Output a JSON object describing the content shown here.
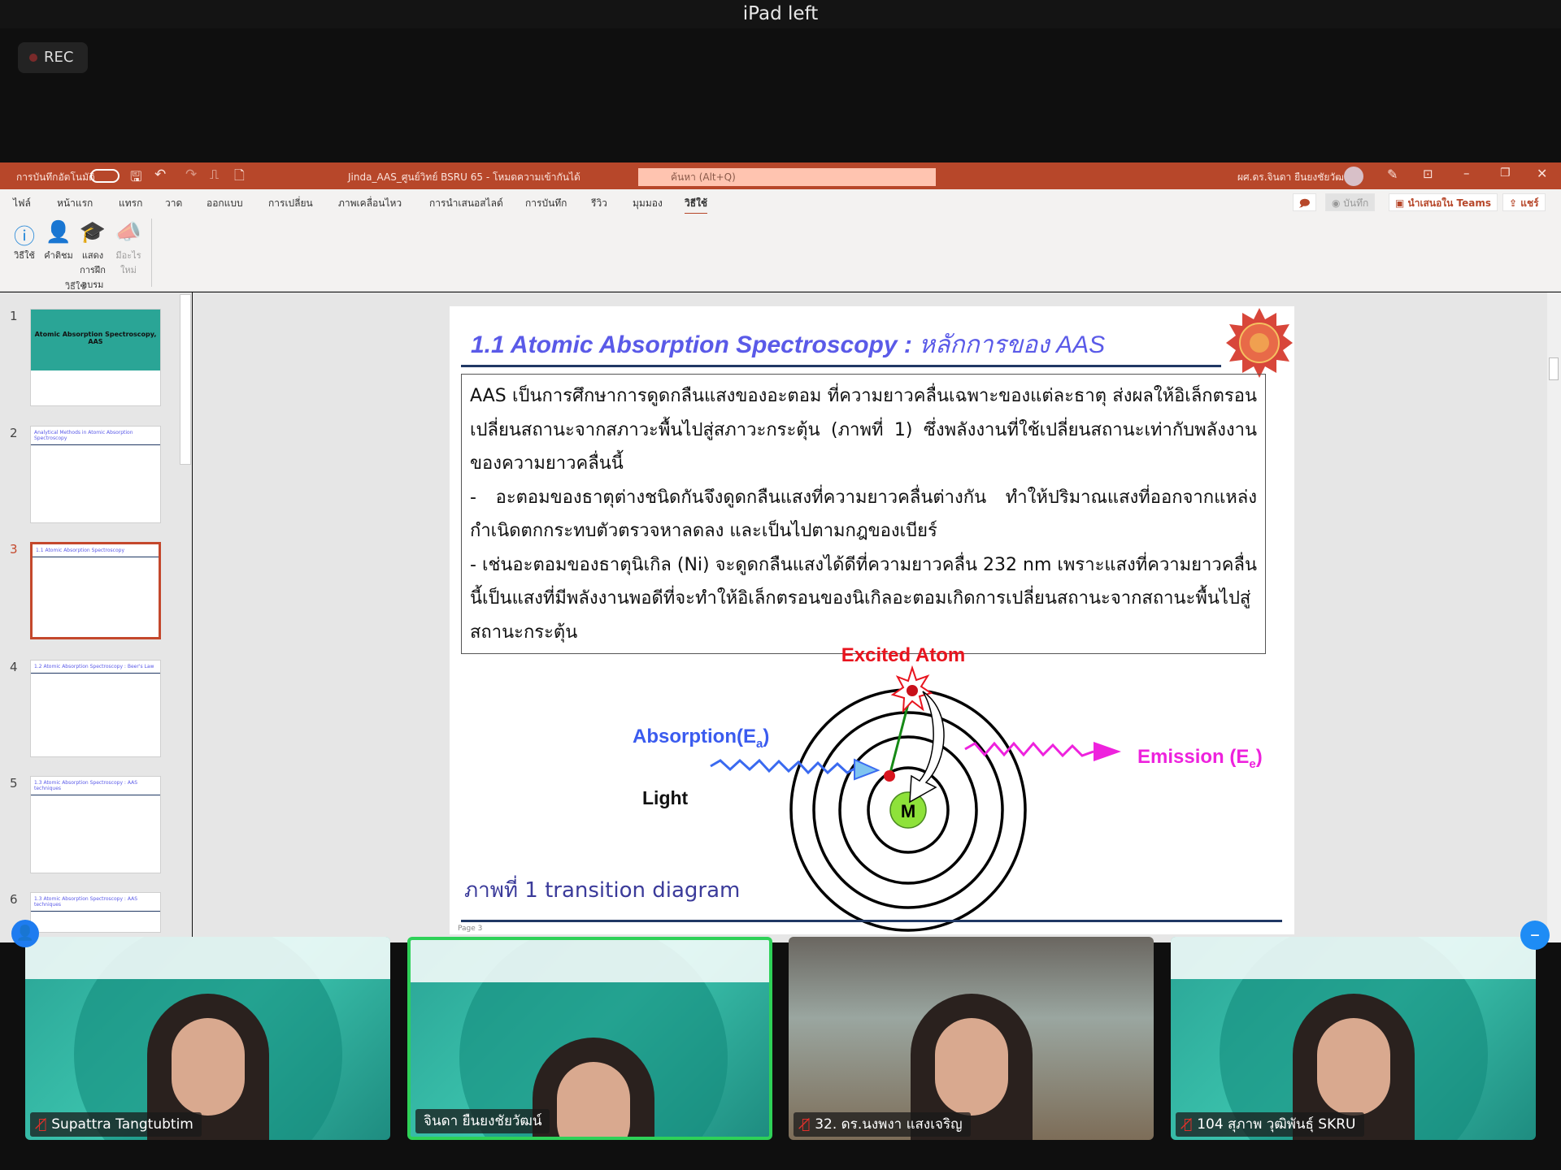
{
  "device": {
    "title": "iPad left",
    "rec_label": "REC"
  },
  "titlebar": {
    "autosave": "การบันทึกอัตโนมัติ",
    "filename": "Jinda_AAS_ศูนย์วิทย์ BSRU 65 - โหมดความเข้ากันได้",
    "search_placeholder": "ค้นหา (Alt+Q)",
    "user": "ผศ.ดร.จินดา ยืนยงชัยวัฒน์"
  },
  "tabs": [
    "ไฟล์",
    "หน้าแรก",
    "แทรก",
    "วาด",
    "ออกแบบ",
    "การเปลี่ยน",
    "ภาพเคลื่อนไหว",
    "การนำเสนอสไลด์",
    "การบันทึก",
    "รีวิว",
    "มุมมอง",
    "วิธีใช้"
  ],
  "active_tab": "วิธีใช้",
  "ribbon": {
    "buttons": [
      {
        "icon": "help-icon",
        "label": "วิธีใช้"
      },
      {
        "icon": "feedback-icon",
        "label": "คำติชม"
      },
      {
        "icon": "training-icon",
        "label": "แสดงการฝึกอบรม"
      },
      {
        "icon": "whats-new-icon",
        "label": "มีอะไรใหม่"
      }
    ],
    "group": "วิธีใช้",
    "right": {
      "record": "บันทึก",
      "present_teams": "นำเสนอใน Teams",
      "share": "แชร์"
    }
  },
  "thumbnails": [
    {
      "num": "1",
      "text": "Atomic Absorption Spectroscopy, AAS"
    },
    {
      "num": "2",
      "text": "Analytical Methods in Atomic Absorption Spectroscopy"
    },
    {
      "num": "3",
      "text": "1.1 Atomic Absorption Spectroscopy"
    },
    {
      "num": "4",
      "text": "1.2 Atomic Absorption Spectroscopy : Beer's Law"
    },
    {
      "num": "5",
      "text": "1.3 Atomic Absorption Spectroscopy : AAS techniques"
    },
    {
      "num": "6",
      "text": "1.3 Atomic Absorption Spectroscopy : AAS techniques"
    }
  ],
  "selected_slide": "3",
  "slide": {
    "title_en": "1.1 Atomic Absorption Spectroscopy : ",
    "title_th": "หลักการของ AAS",
    "paragraphs": [
      "AAS เป็นการศึกษาการดูดกลืนแสงของอะตอม ที่ความยาวคลื่นเฉพาะของแต่ละธาตุ ส่งผลให้อิเล็กตรอนเปลี่ยนสถานะจากสภาวะพื้นไปสู่สภาวะกระตุ้น (ภาพที่ 1) ซึ่งพลังงานที่ใช้เปลี่ยนสถานะเท่ากับพลังงานของความยาวคลื่นนี้",
      "- อะตอมของธาตุต่างชนิดกันจึงดูดกลืนแสงที่ความยาวคลื่นต่างกัน ทำให้ปริมาณแสงที่ออกจากแหล่งกำเนิดตกกระทบตัวตรวจหาลดลง และเป็นไปตามกฎของเบียร์",
      "- เช่นอะตอมของธาตุนิเกิล (Ni) จะดูดกลืนแสงได้ดีที่ความยาวคลื่น 232 nm เพราะแสงที่ความยาวคลื่นนี้เป็นแสงที่มีพลังงานพอดีที่จะทำให้อิเล็กตรอนของนิเกิลอะตอมเกิดการเปลี่ยนสถานะจากสถานะพื้นไปสู่สถานะกระตุ้น"
    ],
    "diagram": {
      "excited": "Excited Atom",
      "absorption": "Absorption(E",
      "absorption_sub": "a",
      "emission": "Emission (E",
      "emission_sub": "e",
      "light": "Light",
      "nucleus": "M"
    },
    "caption": "ภาพที่ 1 transition diagram",
    "page": "Page 3"
  },
  "participants": [
    {
      "name": "Supattra Tangtubtim",
      "muted": true
    },
    {
      "name": "จินดา ยืนยงชัยวัฒน์",
      "muted": false,
      "active": true
    },
    {
      "name": "32. ดร.นงพงา แสงเจริญ",
      "muted": true
    },
    {
      "name": "104  สุภาพ วุฒิพันธุ์ SKRU",
      "muted": true
    }
  ],
  "colors": {
    "ppt_orange": "#b7472a",
    "title_blue": "#5a5ae8",
    "absorption_blue": "#3a5bef",
    "emission_magenta": "#ee22dd",
    "excited_red": "#e8141e",
    "nucleus_green": "#8ee23a",
    "active_speaker": "#2ed158"
  }
}
